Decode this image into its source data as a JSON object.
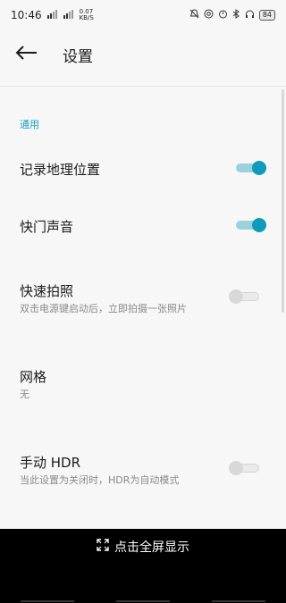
{
  "status": {
    "time": "10:46",
    "net_speed_value": "0.07",
    "net_speed_unit": "KB/S",
    "battery": "84"
  },
  "header": {
    "title": "设置"
  },
  "section": {
    "label": "通用"
  },
  "settings": [
    {
      "title": "记录地理位置",
      "subtitle": "",
      "toggle": "on"
    },
    {
      "title": "快门声音",
      "subtitle": "",
      "toggle": "on"
    },
    {
      "title": "快速拍照",
      "subtitle": "双击电源键启动后，立即拍摄一张照片",
      "toggle": "off"
    },
    {
      "title": "网格",
      "subtitle": "无"
    },
    {
      "title": "手动 HDR",
      "subtitle": "当此设置为关闭时，HDR为自动模式",
      "toggle": "off"
    }
  ],
  "bottom": {
    "fullscreen_label": "点击全屏显示"
  },
  "colors": {
    "accent": "#0f9cbc",
    "accent_track": "#9ad1de"
  }
}
